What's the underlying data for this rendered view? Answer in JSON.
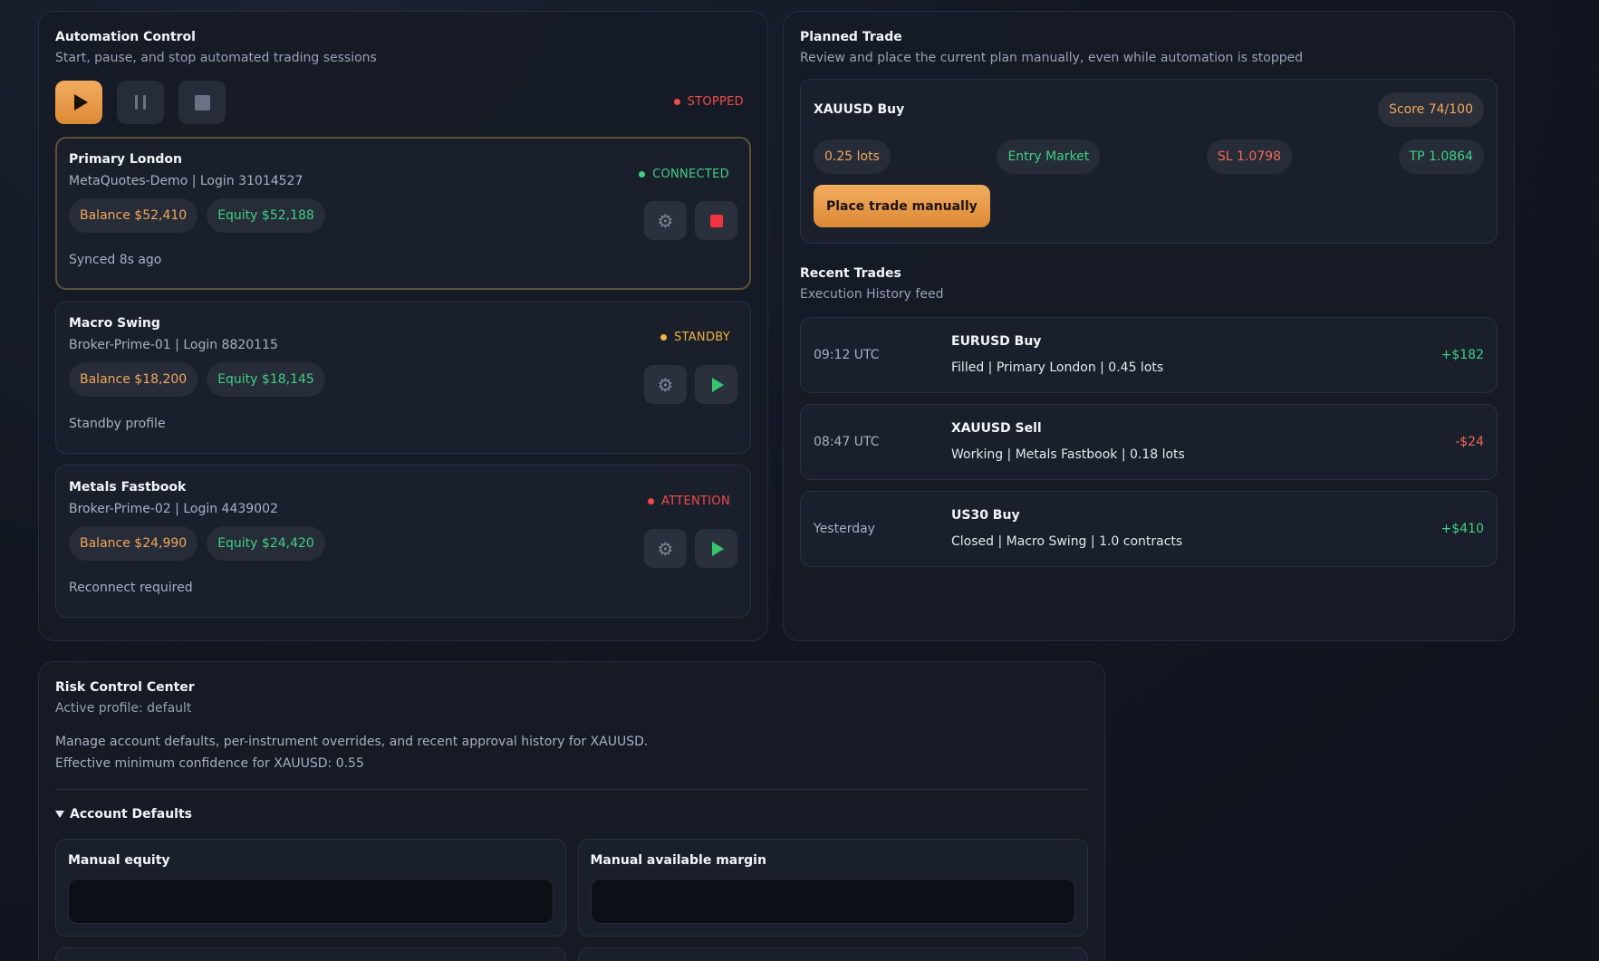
{
  "automation": {
    "title": "Automation Control",
    "subtitle": "Start, pause, and stop automated trading sessions",
    "status": "STOPPED",
    "status_color": "#f04a4a",
    "accounts": [
      {
        "name": "Primary London",
        "broker": "MetaQuotes-Demo | Login 31014527",
        "status": "CONNECTED",
        "status_color": "#3fcf85",
        "balance": "Balance $52,410",
        "equity": "Equity $52,188",
        "note": "Synced 8s ago",
        "action_icon": "stop-icon"
      },
      {
        "name": "Macro Swing",
        "broker": "Broker-Prime-01 | Login 8820115",
        "status": "STANDBY",
        "status_color": "#f2b33a",
        "balance": "Balance $18,200",
        "equity": "Equity $18,145",
        "note": "Standby profile",
        "action_icon": "play-icon"
      },
      {
        "name": "Metals Fastbook",
        "broker": "Broker-Prime-02 | Login 4439002",
        "status": "ATTENTION",
        "status_color": "#f04a4a",
        "balance": "Balance $24,990",
        "equity": "Equity $24,420",
        "note": "Reconnect required",
        "action_icon": "play-icon"
      }
    ]
  },
  "planned": {
    "title": "Planned Trade",
    "subtitle": "Review and place the current plan manually, even while automation is stopped",
    "instrument": "XAUUSD Buy",
    "score": "Score 74/100",
    "lots": "0.25 lots",
    "entry": "Entry Market",
    "sl": "SL 1.0798",
    "tp": "TP 1.0864",
    "place_button": "Place trade manually"
  },
  "recent": {
    "title": "Recent Trades",
    "subtitle": "Execution History feed",
    "trades": [
      {
        "time": "09:12 UTC",
        "name": "EURUSD Buy",
        "detail": "Filled | Primary London | 0.45 lots",
        "pnl": "+$182",
        "pnl_color": "#3fcf85"
      },
      {
        "time": "08:47 UTC",
        "name": "XAUUSD Sell",
        "detail": "Working | Metals Fastbook | 0.18 lots",
        "pnl": "-$24",
        "pnl_color": "#f06a5a"
      },
      {
        "time": "Yesterday",
        "name": "US30 Buy",
        "detail": "Closed | Macro Swing | 1.0 contracts",
        "pnl": "+$410",
        "pnl_color": "#3fcf85"
      }
    ]
  },
  "risk": {
    "title": "Risk Control Center",
    "subtitle": "Active profile: default",
    "desc_line1": "Manage account defaults, per-instrument overrides, and recent approval history for XAUUSD.",
    "desc_line2": "Effective minimum confidence for XAUUSD: 0.55",
    "section": "Account Defaults",
    "field1_label": "Manual equity",
    "field1_value": "",
    "field2_label": "Manual available margin",
    "field2_value": ""
  }
}
